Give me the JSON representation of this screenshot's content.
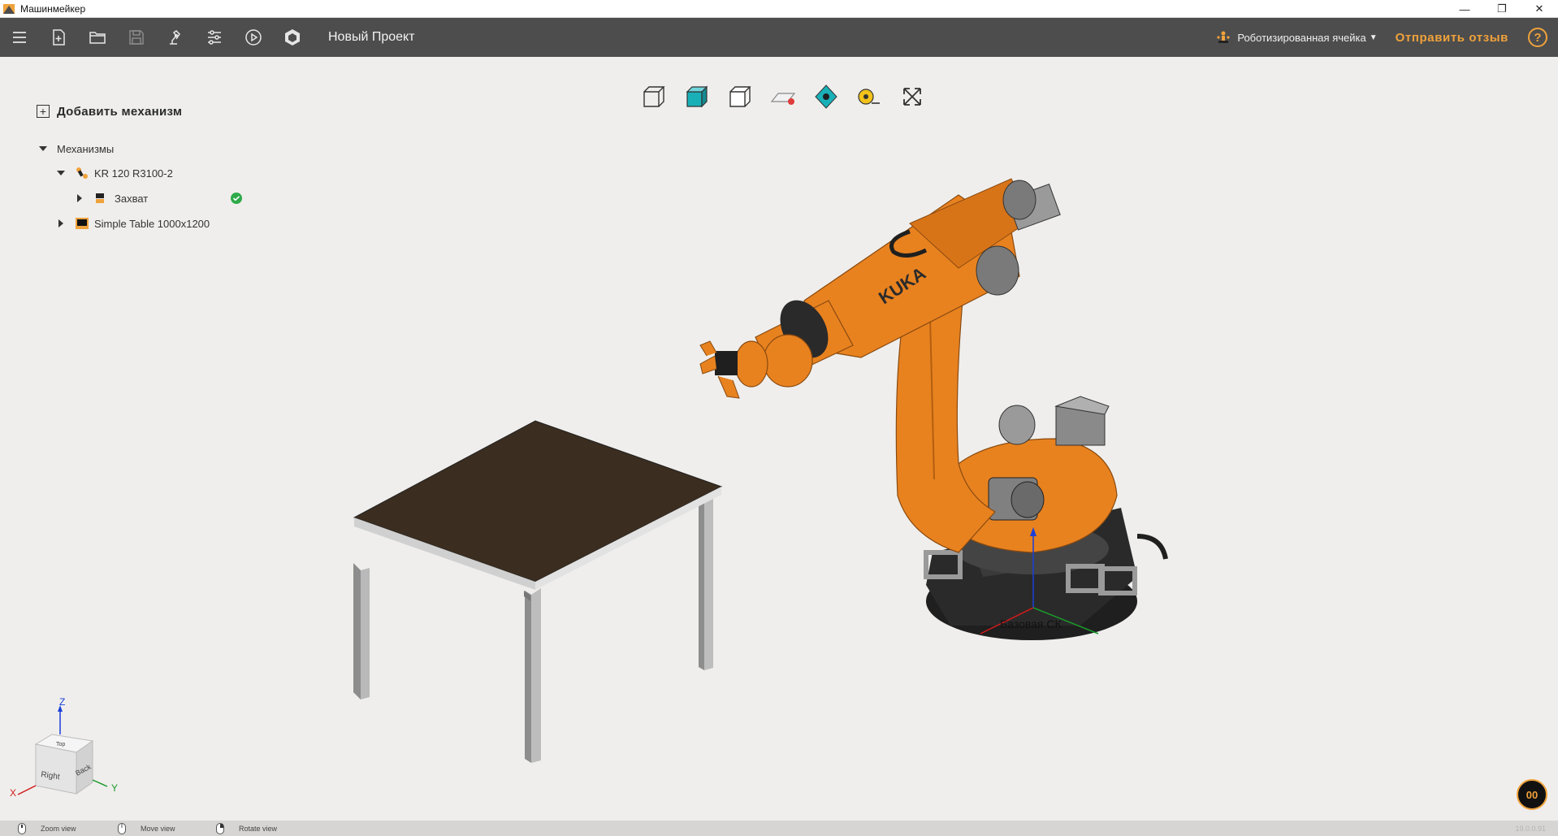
{
  "window": {
    "title": "Машинмейкер",
    "minimize": "—",
    "maximize": "❐",
    "close": "✕"
  },
  "toolbar": {
    "project_name": "Новый Проект",
    "cell_mode_label": "Роботизированная ячейка",
    "cell_mode_caret": "▼",
    "feedback_label": "Отправить отзыв",
    "help_label": "?"
  },
  "tree": {
    "add_label": "Добавить механизм",
    "root_label": "Механизмы",
    "items": [
      {
        "label": "KR 120 R3100-2"
      },
      {
        "label": "Захват"
      },
      {
        "label": "Simple Table 1000x1200"
      }
    ]
  },
  "viewport": {
    "robot_brand": "KUKA",
    "base_frame_label": "Базовая СК"
  },
  "view_cube": {
    "face_right": "Right",
    "face_back": "Back",
    "face_top": "Top",
    "axis_z": "Z",
    "axis_y": "Y",
    "axis_x": "X"
  },
  "timer": "00",
  "statusbar": {
    "zoom": "Zoom view",
    "move": "Move view",
    "rotate": "Rotate view",
    "version": "19.0.0.91"
  },
  "colors": {
    "accent": "#f0a23b",
    "toolbar_bg": "#4d4d4d",
    "robot_orange": "#e8821f",
    "table_top": "#3b2d1f"
  }
}
